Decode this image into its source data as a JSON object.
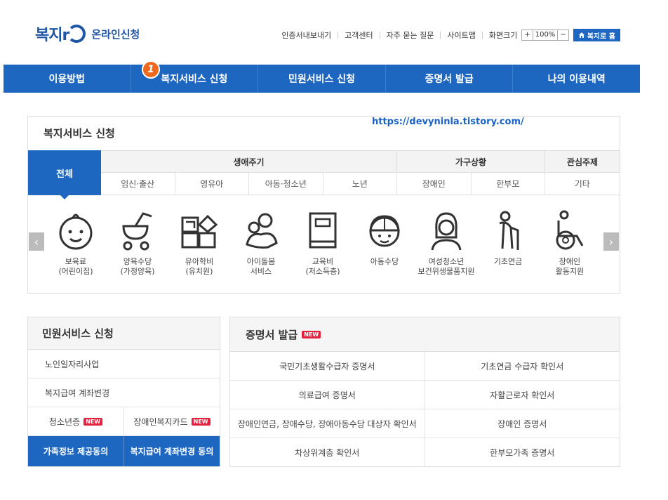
{
  "header": {
    "logo_text": "복지r",
    "logo_sub": "온라인신청",
    "util_links": [
      "인증서내보내기",
      "고객센터",
      "자주 묻는 질문",
      "사이트맵"
    ],
    "zoom_label": "화면크기",
    "zoom_plus": "+",
    "zoom_value": "100%",
    "zoom_minus": "−",
    "home_label": "복지로 홈"
  },
  "nav": {
    "items": [
      "이용방법",
      "복지서비스 신청",
      "민원서비스 신청",
      "증명서 발급",
      "나의 이용내역"
    ],
    "badge": "1"
  },
  "watermark": "https://devyninla.tistory.com/",
  "welfare": {
    "title": "복지서비스 신청",
    "all_label": "전체",
    "groups": [
      "생애주기",
      "가구상황",
      "관심주제"
    ],
    "subs": [
      "임신·출산",
      "영유아",
      "아동·청소년",
      "노년",
      "장애인",
      "한부모",
      "기타"
    ],
    "items": [
      {
        "icon": "baby-face-icon",
        "label": "보육료\n(어린이집)"
      },
      {
        "icon": "stroller-icon",
        "label": "양육수당\n(가정양육)"
      },
      {
        "icon": "letter-blocks-icon",
        "label": "유아학비\n(유치원)"
      },
      {
        "icon": "caregiver-icon",
        "label": "아이돌봄\n서비스"
      },
      {
        "icon": "book-icon",
        "label": "교육비\n(저소득층)"
      },
      {
        "icon": "child-cap-icon",
        "label": "아동수당"
      },
      {
        "icon": "girl-icon",
        "label": "여성청소년\n보건위생물품지원"
      },
      {
        "icon": "elderly-cane-icon",
        "label": "기초연금"
      },
      {
        "icon": "wheelchair-icon",
        "label": "장애인\n활동지원"
      }
    ],
    "prev_arrow": "‹",
    "next_arrow": "›"
  },
  "civil": {
    "title": "민원서비스 신청",
    "rows": [
      "노인일자리사업",
      "복지급여 계좌변경"
    ],
    "split": [
      "청소년증",
      "장애인복지카드"
    ],
    "new_label": "NEW",
    "blue_buttons": [
      "가족정보 제공동의",
      "복지급여 계좌변경 동의"
    ]
  },
  "cert": {
    "title": "증명서 발급",
    "new_label": "NEW",
    "cells": [
      "국민기초생활수급자 증명서",
      "기초연금 수급자 확인서",
      "의료급여 증명서",
      "자활근로자 확인서",
      "장애인연금, 장애수당, 장애아동수당 대상자 확인서",
      "장애인 증명서",
      "차상위계층 확인서",
      "한부모가족 증명서"
    ]
  },
  "colors": {
    "brand_blue": "#1e67c1",
    "badge_orange": "#ef6a1e",
    "new_red": "#e5203f"
  }
}
